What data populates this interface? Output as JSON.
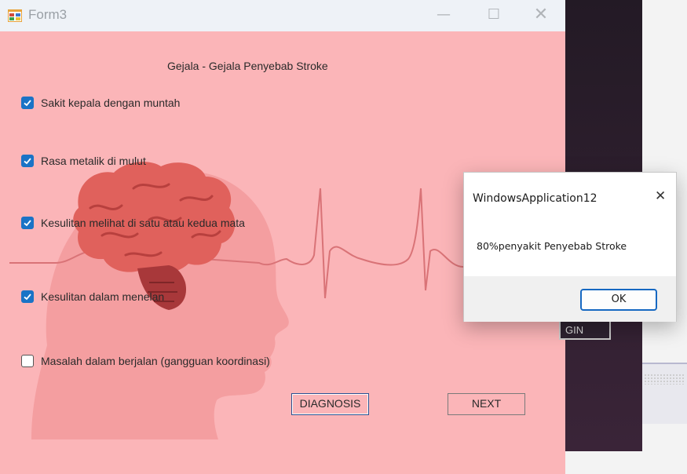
{
  "window": {
    "title": "Form3",
    "minimize_glyph": "—",
    "maximize_glyph": "☐",
    "close_glyph": "✕"
  },
  "form": {
    "heading": "Gejala - Gejala Penyebab Stroke",
    "symptoms": [
      {
        "label": "Sakit kepala dengan muntah",
        "checked": true
      },
      {
        "label": "Rasa metalik di mulut",
        "checked": true
      },
      {
        "label": "Kesulitan melihat di satu atau kedua mata",
        "checked": true
      },
      {
        "label": "Kesulitan dalam menelan",
        "checked": true
      },
      {
        "label": "Masalah dalam berjalan (gangguan koordinasi)",
        "checked": false
      }
    ],
    "diagnosis_label": "DIAGNOSIS",
    "next_label": "NEXT"
  },
  "background": {
    "login_button_partial": "GIN"
  },
  "messagebox": {
    "title": "WindowsApplication12",
    "close_glyph": "✕",
    "message": "80%penyakit Penyebab Stroke",
    "ok_label": "OK"
  },
  "colors": {
    "form_background": "#fbb5b8",
    "checkbox_checked": "#1a73c6",
    "brain": "#e0615c",
    "head_silhouette": "#f49ea0",
    "heartbeat_line": "#d97377"
  },
  "icons": {
    "app": "windows-form-icon",
    "checkmark": "checkmark-icon"
  }
}
